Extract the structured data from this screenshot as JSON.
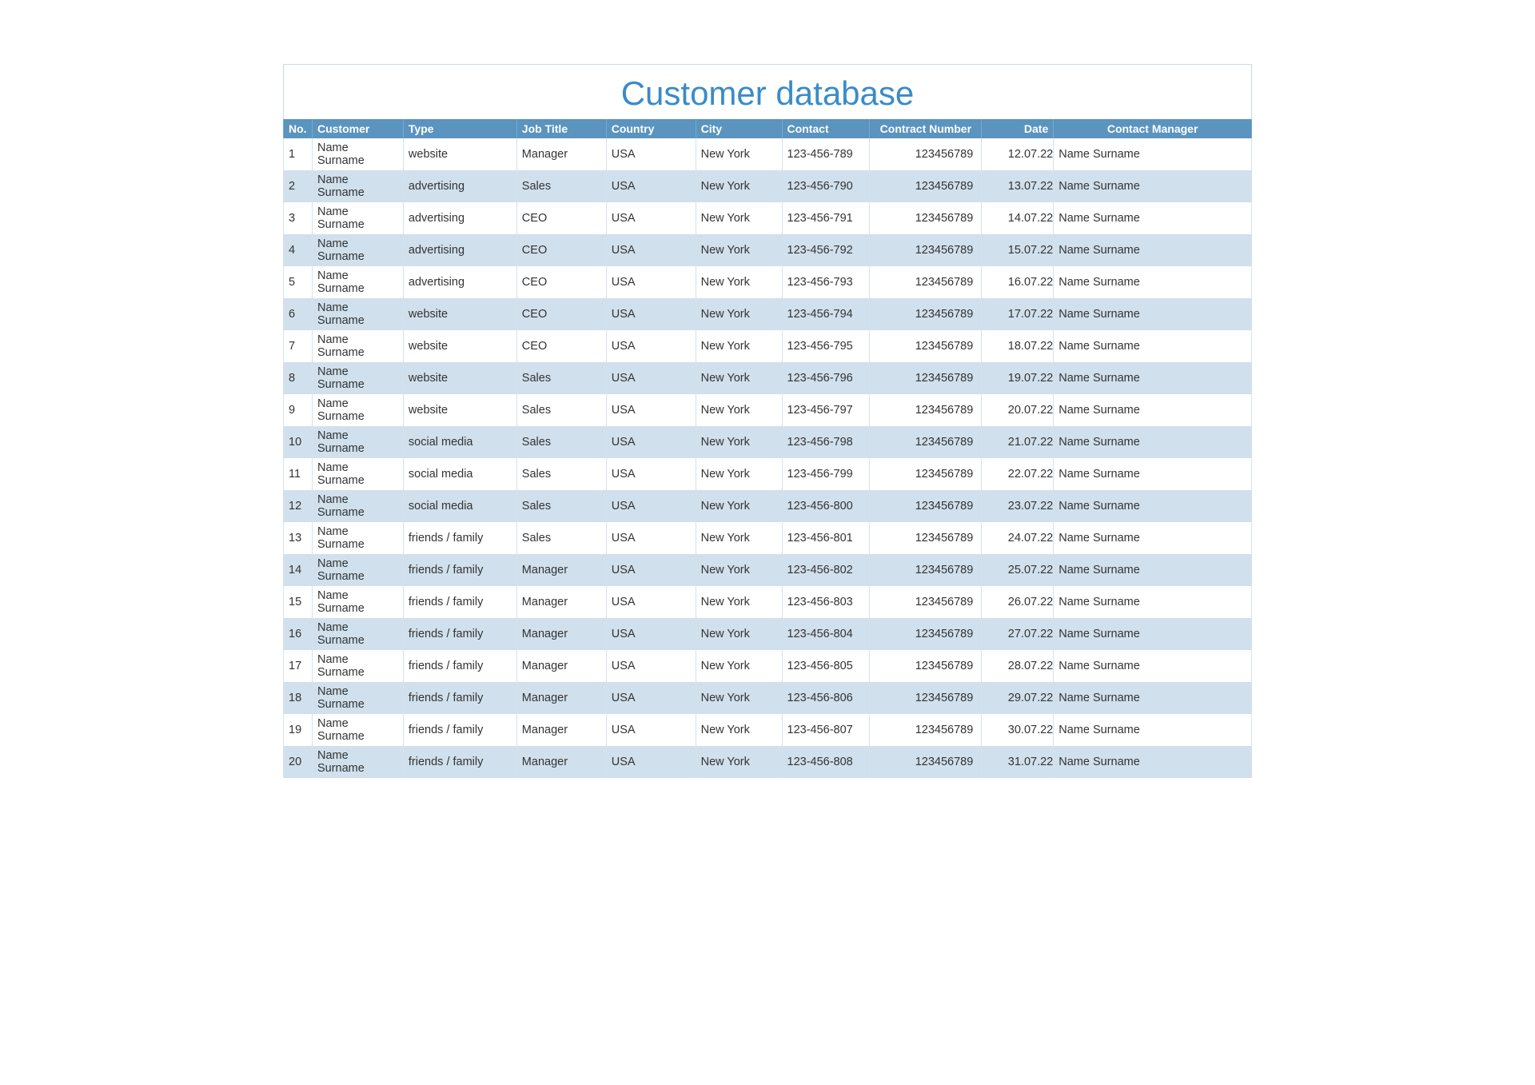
{
  "title": "Customer database",
  "headers": {
    "no": "No.",
    "customer": "Customer",
    "type": "Type",
    "job": "Job Title",
    "country": "Country",
    "city": "City",
    "contact": "Contact",
    "contract": "Contract Number",
    "date": "Date",
    "manager": "Contact Manager"
  },
  "rows": [
    {
      "no": "1",
      "customer": "Name Surname",
      "type": "website",
      "job": "Manager",
      "country": "USA",
      "city": "New York",
      "contact": "123-456-789",
      "contract": "123456789",
      "date": "12.07.22",
      "manager": "Name Surname"
    },
    {
      "no": "2",
      "customer": "Name Surname",
      "type": "advertising",
      "job": "Sales",
      "country": "USA",
      "city": "New York",
      "contact": "123-456-790",
      "contract": "123456789",
      "date": "13.07.22",
      "manager": "Name Surname"
    },
    {
      "no": "3",
      "customer": "Name Surname",
      "type": "advertising",
      "job": "CEO",
      "country": "USA",
      "city": "New York",
      "contact": "123-456-791",
      "contract": "123456789",
      "date": "14.07.22",
      "manager": "Name Surname"
    },
    {
      "no": "4",
      "customer": "Name Surname",
      "type": "advertising",
      "job": "CEO",
      "country": "USA",
      "city": "New York",
      "contact": "123-456-792",
      "contract": "123456789",
      "date": "15.07.22",
      "manager": "Name Surname"
    },
    {
      "no": "5",
      "customer": "Name Surname",
      "type": "advertising",
      "job": "CEO",
      "country": "USA",
      "city": "New York",
      "contact": "123-456-793",
      "contract": "123456789",
      "date": "16.07.22",
      "manager": "Name Surname"
    },
    {
      "no": "6",
      "customer": "Name Surname",
      "type": "website",
      "job": "CEO",
      "country": "USA",
      "city": "New York",
      "contact": "123-456-794",
      "contract": "123456789",
      "date": "17.07.22",
      "manager": "Name Surname"
    },
    {
      "no": "7",
      "customer": "Name Surname",
      "type": "website",
      "job": "CEO",
      "country": "USA",
      "city": "New York",
      "contact": "123-456-795",
      "contract": "123456789",
      "date": "18.07.22",
      "manager": "Name Surname"
    },
    {
      "no": "8",
      "customer": "Name Surname",
      "type": "website",
      "job": "Sales",
      "country": "USA",
      "city": "New York",
      "contact": "123-456-796",
      "contract": "123456789",
      "date": "19.07.22",
      "manager": "Name Surname"
    },
    {
      "no": "9",
      "customer": "Name Surname",
      "type": "website",
      "job": "Sales",
      "country": "USA",
      "city": "New York",
      "contact": "123-456-797",
      "contract": "123456789",
      "date": "20.07.22",
      "manager": "Name Surname"
    },
    {
      "no": "10",
      "customer": "Name Surname",
      "type": "social media",
      "job": "Sales",
      "country": "USA",
      "city": "New York",
      "contact": "123-456-798",
      "contract": "123456789",
      "date": "21.07.22",
      "manager": "Name Surname"
    },
    {
      "no": "11",
      "customer": "Name Surname",
      "type": "social media",
      "job": "Sales",
      "country": "USA",
      "city": "New York",
      "contact": "123-456-799",
      "contract": "123456789",
      "date": "22.07.22",
      "manager": "Name Surname"
    },
    {
      "no": "12",
      "customer": "Name Surname",
      "type": "social media",
      "job": "Sales",
      "country": "USA",
      "city": "New York",
      "contact": "123-456-800",
      "contract": "123456789",
      "date": "23.07.22",
      "manager": "Name Surname"
    },
    {
      "no": "13",
      "customer": "Name Surname",
      "type": "friends / family",
      "job": "Sales",
      "country": "USA",
      "city": "New York",
      "contact": "123-456-801",
      "contract": "123456789",
      "date": "24.07.22",
      "manager": "Name Surname"
    },
    {
      "no": "14",
      "customer": "Name Surname",
      "type": "friends / family",
      "job": "Manager",
      "country": "USA",
      "city": "New York",
      "contact": "123-456-802",
      "contract": "123456789",
      "date": "25.07.22",
      "manager": "Name Surname"
    },
    {
      "no": "15",
      "customer": "Name Surname",
      "type": "friends / family",
      "job": "Manager",
      "country": "USA",
      "city": "New York",
      "contact": "123-456-803",
      "contract": "123456789",
      "date": "26.07.22",
      "manager": "Name Surname"
    },
    {
      "no": "16",
      "customer": "Name Surname",
      "type": "friends / family",
      "job": "Manager",
      "country": "USA",
      "city": "New York",
      "contact": "123-456-804",
      "contract": "123456789",
      "date": "27.07.22",
      "manager": "Name Surname"
    },
    {
      "no": "17",
      "customer": "Name Surname",
      "type": "friends / family",
      "job": "Manager",
      "country": "USA",
      "city": "New York",
      "contact": "123-456-805",
      "contract": "123456789",
      "date": "28.07.22",
      "manager": "Name Surname"
    },
    {
      "no": "18",
      "customer": "Name Surname",
      "type": "friends / family",
      "job": "Manager",
      "country": "USA",
      "city": "New York",
      "contact": "123-456-806",
      "contract": "123456789",
      "date": "29.07.22",
      "manager": "Name Surname"
    },
    {
      "no": "19",
      "customer": "Name Surname",
      "type": "friends / family",
      "job": "Manager",
      "country": "USA",
      "city": "New York",
      "contact": "123-456-807",
      "contract": "123456789",
      "date": "30.07.22",
      "manager": "Name Surname"
    },
    {
      "no": "20",
      "customer": "Name Surname",
      "type": "friends / family",
      "job": "Manager",
      "country": "USA",
      "city": "New York",
      "contact": "123-456-808",
      "contract": "123456789",
      "date": "31.07.22",
      "manager": "Name Surname"
    }
  ]
}
